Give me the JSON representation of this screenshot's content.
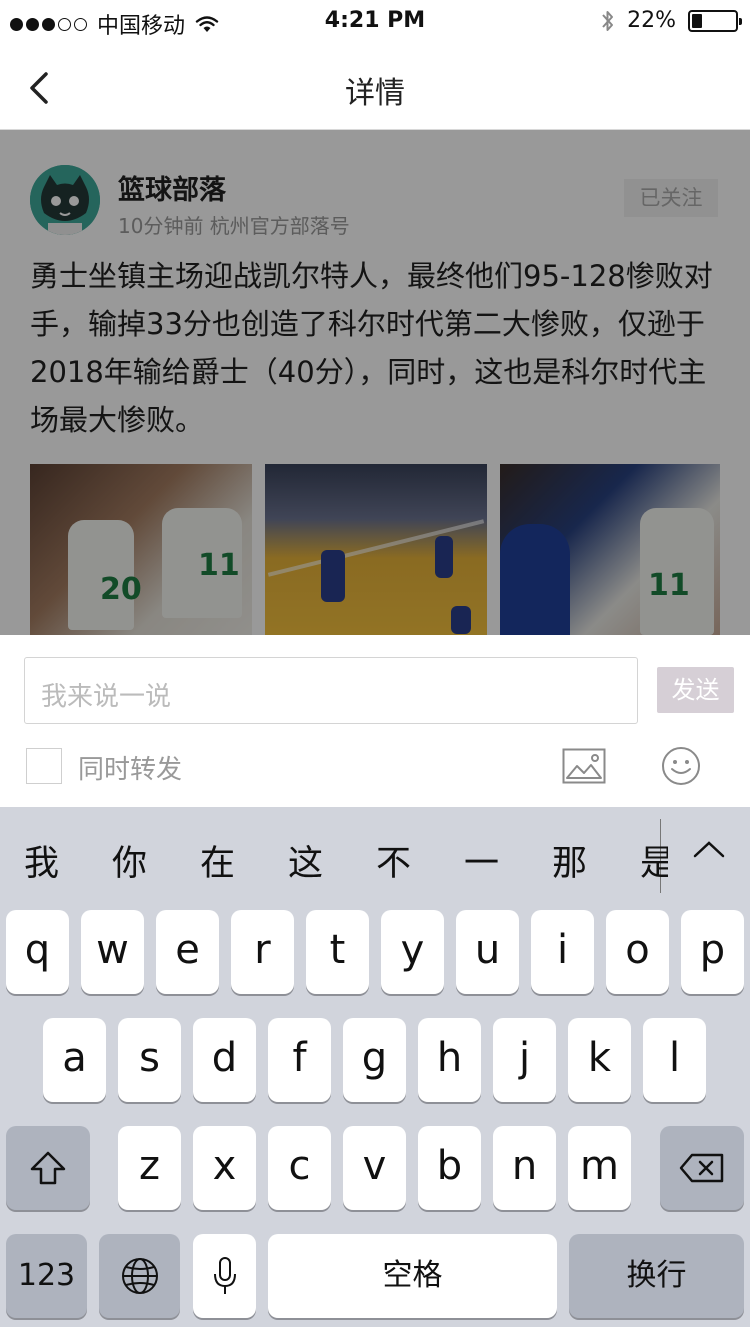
{
  "status_bar": {
    "carrier": "中国移动",
    "time": "4:21 PM",
    "battery_percent": "22%",
    "battery_level": 0.22,
    "signal_filled": 3,
    "signal_total": 5
  },
  "nav": {
    "back_icon": "chevron-left-icon",
    "title": "详情"
  },
  "post": {
    "author": "篮球部落",
    "meta": "10分钟前 杭州官方部落号",
    "follow_label": "已关注",
    "text": "勇士坐镇主场迎战凯尔特人，最终他们95-128惨败对手，输掉33分也创造了科尔时代第二大惨败，仅逊于2018年输给爵士（40分），同时，这也是科尔时代主场最大惨败。"
  },
  "comment": {
    "placeholder": "我来说一说",
    "send_label": "发送",
    "repost_label": "同时转发",
    "image_icon": "image-icon",
    "emoji_icon": "smiley-icon"
  },
  "keyboard": {
    "candidates": [
      "我",
      "你",
      "在",
      "这",
      "不",
      "一",
      "那",
      "是"
    ],
    "row1": [
      "q",
      "w",
      "e",
      "r",
      "t",
      "y",
      "u",
      "i",
      "o",
      "p"
    ],
    "row2": [
      "a",
      "s",
      "d",
      "f",
      "g",
      "h",
      "j",
      "k",
      "l"
    ],
    "row3": [
      "z",
      "x",
      "c",
      "v",
      "b",
      "n",
      "m"
    ],
    "numbers_label": "123",
    "space_label": "空格",
    "return_label": "换行",
    "colors": {
      "background": "#d1d4dc",
      "key": "#ffffff",
      "function_key": "#aeb3be"
    }
  }
}
